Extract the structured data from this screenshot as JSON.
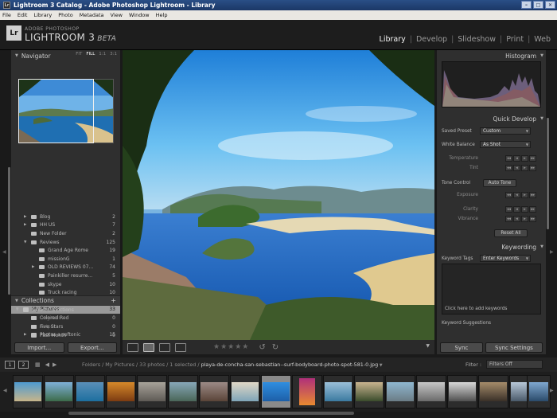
{
  "window": {
    "title": "Lightroom 3 Catalog - Adobe Photoshop Lightroom - Library",
    "app_icon": "Lr",
    "controls": [
      "–",
      "□",
      "✕"
    ]
  },
  "menu": [
    "File",
    "Edit",
    "Library",
    "Photo",
    "Metadata",
    "View",
    "Window",
    "Help"
  ],
  "identity": {
    "badge": "Lr",
    "top": "ADOBE PHOTOSHOP",
    "name": "LIGHTROOM 3",
    "beta": "BETA"
  },
  "modules": [
    "Library",
    "Develop",
    "Slideshow",
    "Print",
    "Web"
  ],
  "active_module": "Library",
  "module_separator": "|",
  "navigator": {
    "title": "Navigator",
    "zoom": [
      "FIT",
      "FILL",
      "1:1",
      "3:1"
    ],
    "zoom_selected": "FILL"
  },
  "folders": [
    {
      "name": "Blog",
      "count": "2",
      "level": 1,
      "state": "collapsed"
    },
    {
      "name": "HH US",
      "count": "7",
      "level": 1,
      "state": "collapsed"
    },
    {
      "name": "New Folder",
      "count": "2",
      "level": 1,
      "state": "none"
    },
    {
      "name": "Reviews",
      "count": "125",
      "level": 1,
      "state": "expanded"
    },
    {
      "name": "Grand Age Rome",
      "count": "19",
      "level": 2,
      "state": "none"
    },
    {
      "name": "missionG",
      "count": "1",
      "level": 2,
      "state": "none"
    },
    {
      "name": "OLD REVIEWS 07...",
      "count": "74",
      "level": 2,
      "state": "collapsed"
    },
    {
      "name": "Painkiller resurre...",
      "count": "5",
      "level": 2,
      "state": "none"
    },
    {
      "name": "skype",
      "count": "10",
      "level": 2,
      "state": "none"
    },
    {
      "name": "Truck racing",
      "count": "10",
      "level": 2,
      "state": "none"
    },
    {
      "name": "Wallp",
      "count": "4",
      "level": 2,
      "state": "collapsed"
    },
    {
      "name": "My Pictures",
      "count": "33",
      "level": 0,
      "state": "expanded",
      "selected": true
    },
    {
      "name": "Originals",
      "count": "",
      "level": 1,
      "state": "none",
      "dim": true
    },
    {
      "name": "output",
      "count": "",
      "level": 1,
      "state": "none",
      "dim": true
    },
    {
      "name": "Photos a softonic",
      "count": "15",
      "level": 1,
      "state": "collapsed"
    }
  ],
  "collections": {
    "title": "Collections",
    "add": "+",
    "items": [
      {
        "name": "Smart Collections",
        "count": "",
        "level": 0
      },
      {
        "name": "Colored Red",
        "count": "0",
        "level": 1
      },
      {
        "name": "Five Stars",
        "count": "0",
        "level": 1
      },
      {
        "name": "Past Month",
        "count": "0",
        "level": 1
      }
    ]
  },
  "left_buttons": {
    "import": "Import...",
    "export": "Export..."
  },
  "toolbar": {
    "stars": "★★★★★",
    "rotate_left": "↺",
    "rotate_right": "↻",
    "chevron": "▼"
  },
  "histogram": {
    "title": "Histogram"
  },
  "quick_develop": {
    "title": "Quick Develop",
    "saved_preset_label": "Saved Preset",
    "saved_preset_value": "Custom",
    "white_balance_label": "White Balance",
    "white_balance_value": "As Shot",
    "temperature": "Temperature",
    "tint": "Tint",
    "tone_control": "Tone Control",
    "auto_tone": "Auto Tone",
    "exposure": "Exposure",
    "clarity": "Clarity",
    "vibrance": "Vibrance",
    "reset_all": "Reset All"
  },
  "keywording": {
    "title": "Keywording",
    "tags_label": "Keyword Tags",
    "tags_value": "Enter Keywords",
    "placeholder": "Click here to add keywords",
    "suggestions": "Keyword Suggestions"
  },
  "right_buttons": {
    "sync": "Sync",
    "sync_settings": "Sync Settings"
  },
  "filmstrip_bar": {
    "view1": "1",
    "view2": "2",
    "path_prefix": "Folders / My Pictures / 33 photos / 1 selected /",
    "file": "playa-de-concha-san-sebastian--surf-bodyboard-photo-spot-581-0.jpg",
    "filter_label": "Filter :",
    "filter_value": "Filters Off"
  },
  "colors": {
    "panel": "#2f2f2f",
    "background": "#1a1a1a",
    "titlebar": "#2a4f86",
    "active_module": "#f2f2f2",
    "selected_folder": "#999999"
  }
}
